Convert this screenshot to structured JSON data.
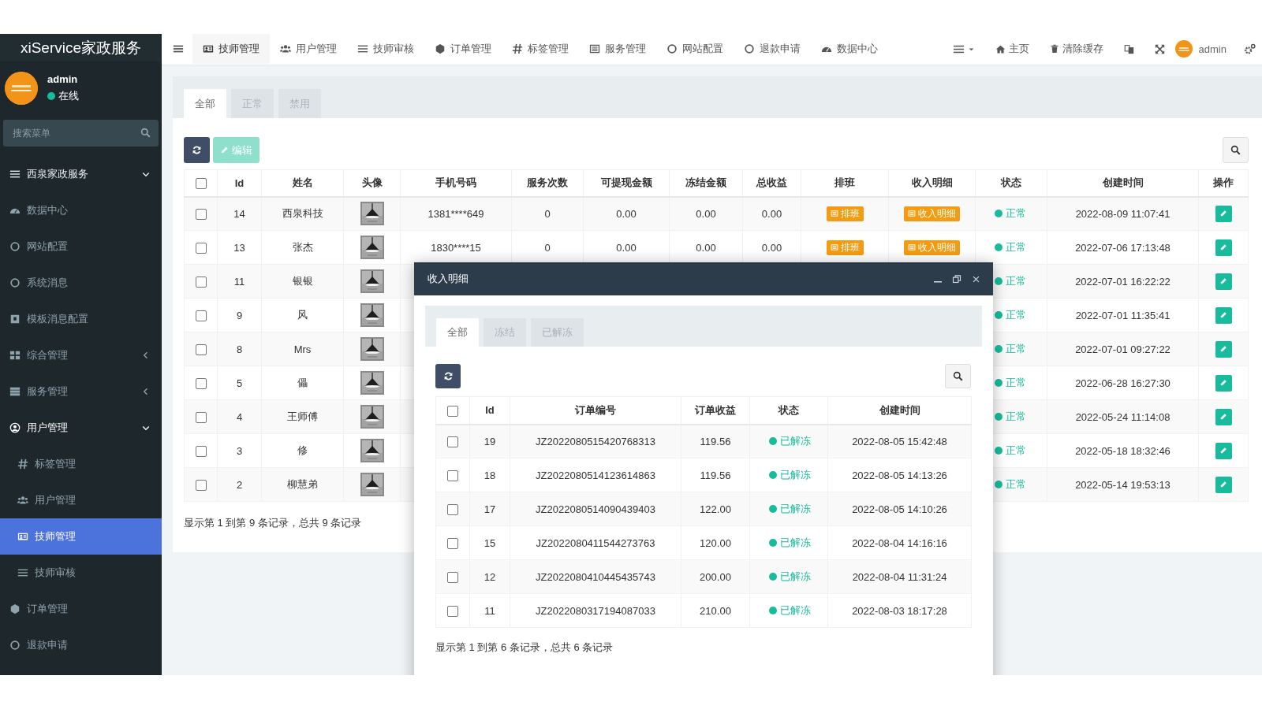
{
  "sidebar": {
    "logo": "xiService家政服务",
    "user": {
      "name": "admin",
      "status": "在线",
      "online": true
    },
    "search": {
      "placeholder": "搜索菜单"
    },
    "items": [
      {
        "label": "西泉家政服务",
        "kind": "section",
        "expanded": true,
        "selected": false
      },
      {
        "label": "数据中心",
        "kind": "item",
        "selected": false
      },
      {
        "label": "网站配置",
        "kind": "item",
        "selected": false
      },
      {
        "label": "系统消息",
        "kind": "item",
        "selected": false
      },
      {
        "label": "模板消息配置",
        "kind": "item",
        "selected": false
      },
      {
        "label": "综合管理",
        "kind": "item",
        "expanded": false,
        "selected": false
      },
      {
        "label": "服务管理",
        "kind": "item",
        "expanded": false,
        "selected": false
      },
      {
        "label": "用户管理",
        "kind": "item",
        "expanded": true,
        "selected": false,
        "children": [
          {
            "label": "标签管理",
            "selected": false
          },
          {
            "label": "用户管理",
            "selected": false
          },
          {
            "label": "技师管理",
            "selected": true
          },
          {
            "label": "技师审核",
            "selected": false
          }
        ]
      },
      {
        "label": "订单管理",
        "kind": "item",
        "selected": false
      },
      {
        "label": "退款申请",
        "kind": "item",
        "selected": false
      }
    ]
  },
  "topbar": {
    "tabs": [
      {
        "label": "技师管理",
        "selected": true
      },
      {
        "label": "用户管理",
        "selected": false
      },
      {
        "label": "技师审核",
        "selected": false
      },
      {
        "label": "订单管理",
        "selected": false
      },
      {
        "label": "标签管理",
        "selected": false
      },
      {
        "label": "服务管理",
        "selected": false
      },
      {
        "label": "网站配置",
        "selected": false
      },
      {
        "label": "退款申请",
        "selected": false
      },
      {
        "label": "数据中心",
        "selected": false
      }
    ],
    "home": "主页",
    "clear_cache": "清除缓存",
    "user": "admin"
  },
  "main": {
    "tabs": [
      {
        "label": "全部",
        "selected": true
      },
      {
        "label": "正常",
        "selected": false
      },
      {
        "label": "禁用",
        "selected": false
      }
    ],
    "edit_button": {
      "label": "编辑",
      "disabled": true
    },
    "table": {
      "all_checked": false,
      "columns": [
        "Id",
        "姓名",
        "头像",
        "手机号码",
        "服务次数",
        "可提现金额",
        "冻结金额",
        "总收益",
        "排班",
        "收入明细",
        "状态",
        "创建时间",
        "操作"
      ],
      "rows": [
        {
          "checked": false,
          "id": "14",
          "name": "西泉科技",
          "phone": "1381****649",
          "service_count": "0",
          "withdrawable": "0.00",
          "frozen": "0.00",
          "total_income": "0.00",
          "schedule": "排班",
          "income_detail": "收入明细",
          "status": "正常",
          "created": "2022-08-09 11:07:41"
        },
        {
          "checked": false,
          "id": "13",
          "name": "张杰",
          "phone": "1830****15",
          "service_count": "0",
          "withdrawable": "0.00",
          "frozen": "0.00",
          "total_income": "0.00",
          "schedule": "排班",
          "income_detail": "收入明细",
          "status": "正常",
          "created": "2022-07-06 17:13:48"
        },
        {
          "checked": false,
          "id": "11",
          "name": "银银",
          "status": "正常",
          "created": "2022-07-01 16:22:22"
        },
        {
          "checked": false,
          "id": "9",
          "name": "风",
          "status": "正常",
          "created": "2022-07-01 11:35:41"
        },
        {
          "checked": false,
          "id": "8",
          "name": "Mrs",
          "status": "正常",
          "created": "2022-07-01 09:27:22"
        },
        {
          "checked": false,
          "id": "5",
          "name": "儡",
          "status": "正常",
          "created": "2022-06-28 16:27:30"
        },
        {
          "checked": false,
          "id": "4",
          "name": "王师傅",
          "status": "正常",
          "created": "2022-05-24 11:14:08"
        },
        {
          "checked": false,
          "id": "3",
          "name": "修",
          "status": "正常",
          "created": "2022-05-18 18:32:46"
        },
        {
          "checked": false,
          "id": "2",
          "name": "柳慧弟",
          "status": "正常",
          "created": "2022-05-14 19:53:13"
        }
      ]
    },
    "footer": "显示第 1 到第 9 条记录，总共 9 条记录"
  },
  "modal": {
    "title": "收入明细",
    "tabs": [
      {
        "label": "全部",
        "selected": true
      },
      {
        "label": "冻结",
        "selected": false
      },
      {
        "label": "已解冻",
        "selected": false
      }
    ],
    "table": {
      "all_checked": false,
      "columns": [
        "Id",
        "订单编号",
        "订单收益",
        "状态",
        "创建时间"
      ],
      "rows": [
        {
          "checked": false,
          "id": "19",
          "order_no": "JZ2022080515420768313",
          "income": "119.56",
          "status": "已解冻",
          "created": "2022-08-05 15:42:48"
        },
        {
          "checked": false,
          "id": "18",
          "order_no": "JZ2022080514123614863",
          "income": "119.56",
          "status": "已解冻",
          "created": "2022-08-05 14:13:26"
        },
        {
          "checked": false,
          "id": "17",
          "order_no": "JZ2022080514090439403",
          "income": "122.00",
          "status": "已解冻",
          "created": "2022-08-05 14:10:26"
        },
        {
          "checked": false,
          "id": "15",
          "order_no": "JZ2022080411544273763",
          "income": "120.00",
          "status": "已解冻",
          "created": "2022-08-04 14:16:16"
        },
        {
          "checked": false,
          "id": "12",
          "order_no": "JZ2022080410445435743",
          "income": "200.00",
          "status": "已解冻",
          "created": "2022-08-04 11:31:24"
        },
        {
          "checked": false,
          "id": "11",
          "order_no": "JZ2022080317194087033",
          "income": "210.00",
          "status": "已解冻",
          "created": "2022-08-03 18:17:28"
        }
      ]
    },
    "footer": "显示第 1 到第 6 条记录，总共 6 条记录"
  }
}
